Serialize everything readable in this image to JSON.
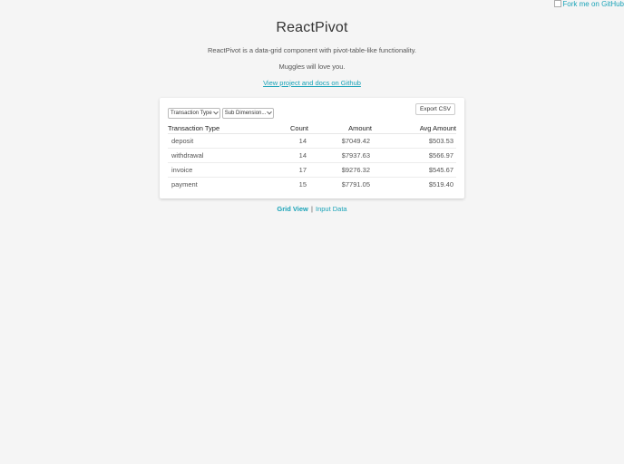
{
  "fork_banner": {
    "alt_text": "Fork me on GitHub"
  },
  "header": {
    "title": "ReactPivot",
    "tagline": "ReactPivot is a data-grid component with pivot-table-like functionality.",
    "muggles": "Muggles will love you.",
    "docs_link": "View project and docs on Github"
  },
  "controls": {
    "dimension_select": "Transaction Type",
    "sub_dimension_select": "Sub Dimension...",
    "export_label": "Export CSV"
  },
  "grid": {
    "headers": {
      "type": "Transaction Type",
      "count": "Count",
      "amount": "Amount",
      "avg": "Avg Amount"
    },
    "rows": [
      {
        "type": "deposit",
        "count": "14",
        "amount": "$7049.42",
        "avg": "$503.53"
      },
      {
        "type": "withdrawal",
        "count": "14",
        "amount": "$7937.63",
        "avg": "$566.97"
      },
      {
        "type": "invoice",
        "count": "17",
        "amount": "$9276.32",
        "avg": "$545.67"
      },
      {
        "type": "payment",
        "count": "15",
        "amount": "$7791.05",
        "avg": "$519.40"
      }
    ]
  },
  "views": {
    "grid_view": "Grid View",
    "separator": "|",
    "input_data": "Input Data"
  },
  "colors": {
    "accent": "#1aa3b8",
    "background": "#f5f5f5"
  }
}
